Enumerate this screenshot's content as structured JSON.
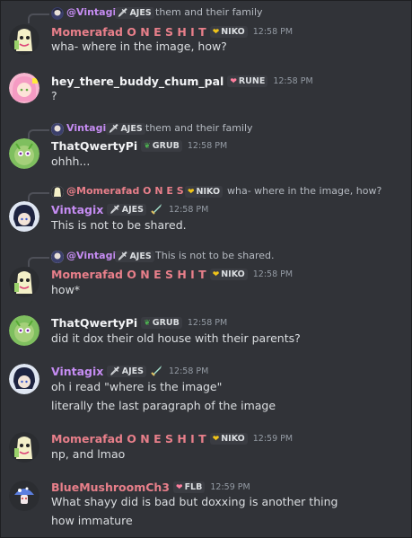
{
  "colors": {
    "background": "#313338",
    "momerafad": "#e87f8a",
    "vintagix": "#c58cf2",
    "qwerty": "#f2f3f5",
    "hey": "#f2f3f5",
    "blue": "#e87f8a"
  },
  "messages": [
    {
      "reply": {
        "name": "@Vintagix",
        "tag": "AJES",
        "tag_icon": "sword-icon",
        "text": "them and their family"
      },
      "author": "Momerafad O N E S H I T",
      "tag": "NIKO",
      "tag_icon": "heart-icon",
      "time": "12:58 PM",
      "avatar": "mascot-avatar",
      "lines": [
        "wha- where in the image, how?"
      ]
    },
    {
      "author": "hey_there_buddy_chum_pal",
      "tag": "RUNE",
      "tag_icon": "heart-icon",
      "time": "12:58 PM",
      "avatar": "pink-hair-avatar",
      "lines": [
        "?"
      ]
    },
    {
      "reply": {
        "name": "Vintagix",
        "tag": "AJES",
        "tag_icon": "sword-icon",
        "text": "them and their family"
      },
      "author": "ThatQwertyPi",
      "tag": "GRUB",
      "tag_icon": "leaf-icon",
      "time": "12:58 PM",
      "avatar": "green-creature-avatar",
      "lines": [
        "ohhh..."
      ]
    },
    {
      "reply": {
        "name": "@Momerafad O N E S H I T",
        "tag": "NIKO",
        "tag_icon": "heart-icon",
        "text": "wha- where in the image, how?"
      },
      "author": "Vintagix",
      "tag": "AJES",
      "tag_icon": "sword-icon",
      "time": "12:58 PM",
      "avatar": "dark-hair-avatar",
      "lines": [
        "This is not to be shared."
      ]
    },
    {
      "reply": {
        "name": "@Vintagix",
        "tag": "AJES",
        "tag_icon": "sword-icon",
        "text": "This is not to be shared."
      },
      "author": "Momerafad O N E S H I T",
      "tag": "NIKO",
      "tag_icon": "heart-icon",
      "time": "12:58 PM",
      "avatar": "mascot-avatar",
      "lines": [
        "how*"
      ]
    },
    {
      "author": "ThatQwertyPi",
      "tag": "GRUB",
      "tag_icon": "leaf-icon",
      "time": "12:58 PM",
      "avatar": "green-creature-avatar",
      "lines": [
        "did it dox their old house with their parents?"
      ]
    },
    {
      "author": "Vintagix",
      "tag": "AJES",
      "tag_icon": "sword-icon",
      "time": "12:58 PM",
      "avatar": "dark-hair-avatar",
      "lines": [
        "oh i read \"where is the image\"",
        "literally the last paragraph of the image"
      ]
    },
    {
      "author": "Momerafad O N E S H I T",
      "tag": "NIKO",
      "tag_icon": "heart-icon",
      "time": "12:59 PM",
      "avatar": "mascot-avatar",
      "lines": [
        "np, and lmao"
      ]
    },
    {
      "author": "BlueMushroomCh3",
      "tag": "FLB",
      "tag_icon": "heart-icon",
      "time": "12:59 PM",
      "avatar": "blue-mushroom-avatar",
      "lines": [
        "What shayy did is bad but doxxing is another thing",
        "how immature"
      ]
    }
  ]
}
